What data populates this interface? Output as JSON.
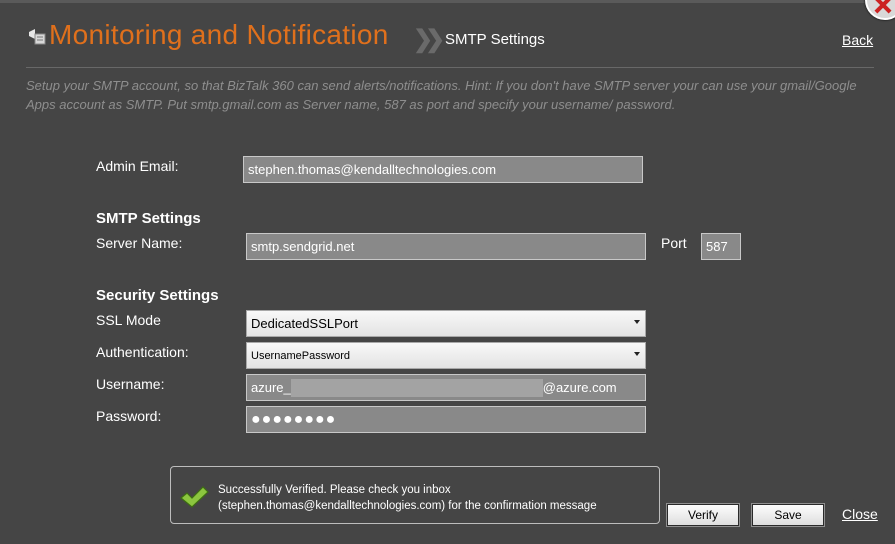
{
  "header": {
    "title": "Monitoring and Notification",
    "subtitle": "SMTP Settings",
    "back_label": "Back",
    "title_color": "#e0701c"
  },
  "hint": "Setup your SMTP account, so that BizTalk 360 can send alerts/notifications. Hint: If you don't have SMTP server your can use your gmail/Google Apps account as SMTP. Put smtp.gmail.com as Server name, 587 as port and specify your username/ password.",
  "admin": {
    "label": "Admin Email:",
    "value": "stephen.thomas@kendalltechnologies.com"
  },
  "smtp": {
    "heading": "SMTP Settings",
    "server_label": "Server Name:",
    "server_value": "smtp.sendgrid.net",
    "port_label": "Port",
    "port_value": "587"
  },
  "security": {
    "heading": "Security Settings",
    "ssl_label": "SSL Mode",
    "ssl_value": "DedicatedSSLPort",
    "auth_label": "Authentication:",
    "auth_value": "UsernamePassword",
    "username_label": "Username:",
    "username_prefix": "azure_",
    "username_suffix": "@azure.com",
    "password_label": "Password:",
    "password_value": "●●●●●●●●"
  },
  "message": {
    "line1": "Successfully Verified. Please check you inbox",
    "line2": "(stephen.thomas@kendalltechnologies.com) for the confirmation message",
    "icon": "checkmark-icon"
  },
  "buttons": {
    "verify": "Verify",
    "save": "Save",
    "close": "Close"
  }
}
